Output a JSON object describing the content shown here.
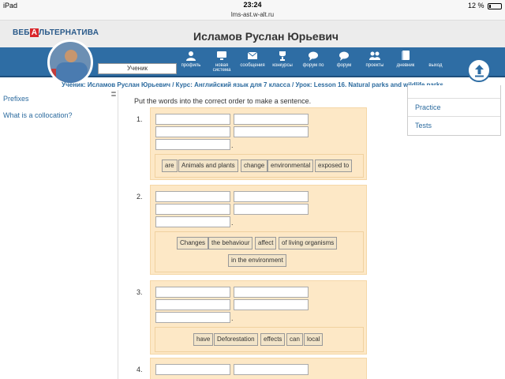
{
  "status_bar": {
    "device": "iPad",
    "time": "23:24",
    "battery": "12 %",
    "url": "lms-ast.w-alt.ru"
  },
  "header": {
    "logo_part1": "ВЕБ",
    "logo_part2": "А",
    "logo_part3": "ЛЬТЕРНАТИВА",
    "user_name": "Исламов Руслан Юрьевич",
    "role": "Ученик"
  },
  "nav": {
    "items": [
      {
        "label": "профиль",
        "icon": "user-icon"
      },
      {
        "label": "новая система",
        "icon": "monitor-icon"
      },
      {
        "label": "сообщения",
        "icon": "envelope-icon"
      },
      {
        "label": "конкурсы",
        "icon": "trophy-icon"
      },
      {
        "label": "форум по",
        "icon": "chat-icon"
      },
      {
        "label": "форум",
        "icon": "chat-icon"
      },
      {
        "label": "проекты",
        "icon": "people-icon"
      },
      {
        "label": "дневник",
        "icon": "book-icon"
      },
      {
        "label": "выход",
        "icon": "exit-icon"
      }
    ]
  },
  "breadcrumb": "Ученик: Исламов Руслан Юрьевич / Курс: Английский язык для 7 класса / Урок: Lesson 16. Natural parks and wildlife parks",
  "left_sidebar": {
    "links": [
      "Prefixes",
      "What is a collocation?"
    ]
  },
  "right_sidebar": {
    "items": [
      "Practice",
      "Tests"
    ]
  },
  "exercise": {
    "instruction": "Put the words into the correct order to make a sentence.",
    "questions": [
      {
        "number": "1.",
        "words": [
          "are",
          "Animals and plants",
          "change",
          "environmental",
          "exposed to"
        ]
      },
      {
        "number": "2.",
        "words": [
          "Changes",
          "the behaviour",
          "affect",
          "of living organisms",
          "in the environment"
        ]
      },
      {
        "number": "3.",
        "words": [
          "have",
          "Deforestation",
          "effects",
          "can",
          "local"
        ]
      },
      {
        "number": "4.",
        "words": []
      }
    ],
    "period": "."
  }
}
